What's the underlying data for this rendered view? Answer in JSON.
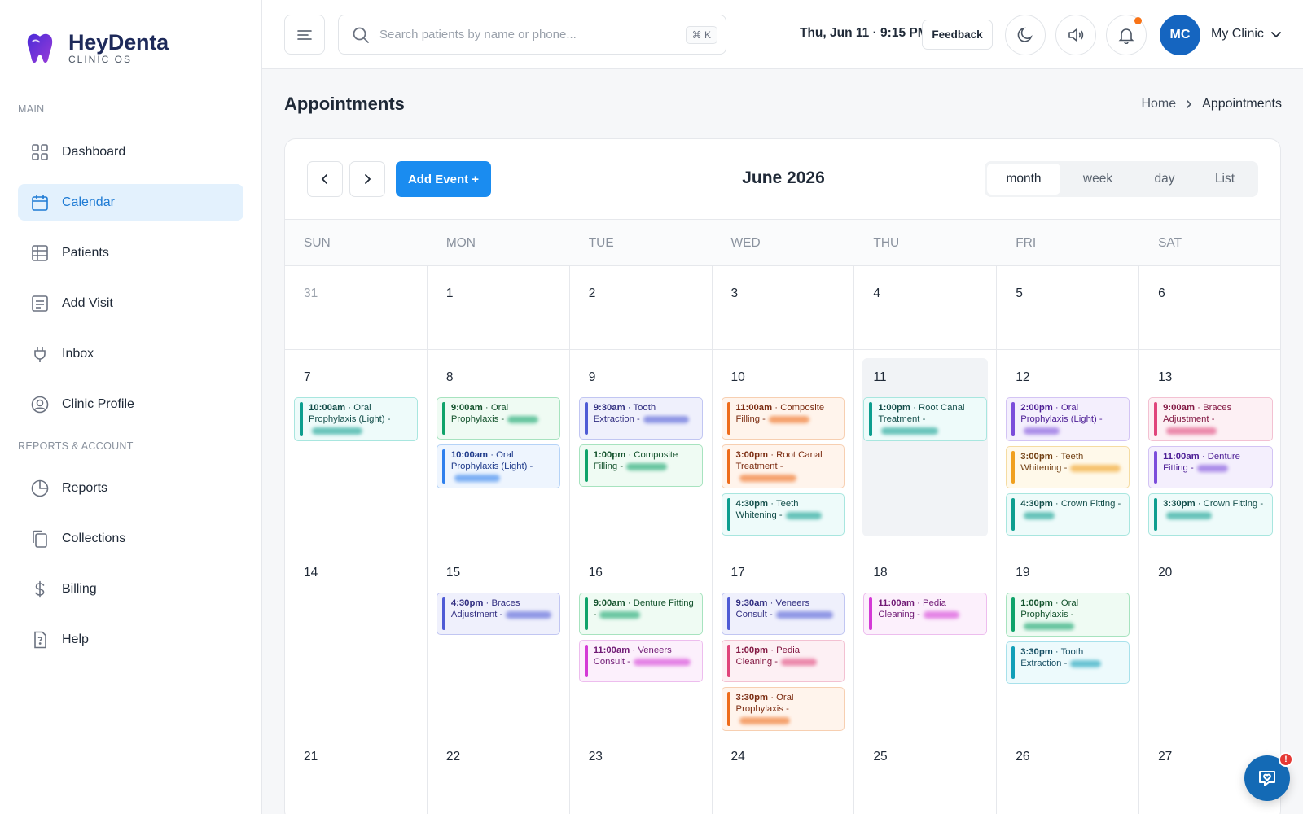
{
  "brand": {
    "name": "HeyDenta",
    "subtitle": "CLINIC OS"
  },
  "sidebar": {
    "main_label": "MAIN",
    "reports_label": "REPORTS & ACCOUNT",
    "main_items": [
      {
        "label": "Dashboard",
        "icon": "dashboard-grid-icon"
      },
      {
        "label": "Calendar",
        "icon": "calendar-icon",
        "active": true
      },
      {
        "label": "Patients",
        "icon": "table-icon"
      },
      {
        "label": "Add Visit",
        "icon": "document-list-icon"
      },
      {
        "label": "Inbox",
        "icon": "plug-icon"
      },
      {
        "label": "Clinic Profile",
        "icon": "user-circle-icon"
      }
    ],
    "report_items": [
      {
        "label": "Reports",
        "icon": "pie-chart-icon"
      },
      {
        "label": "Collections",
        "icon": "copy-icon"
      },
      {
        "label": "Billing",
        "icon": "dollar-icon"
      },
      {
        "label": "Help",
        "icon": "help-document-icon"
      }
    ]
  },
  "topbar": {
    "search_placeholder": "Search patients by name or phone...",
    "shortcut": "⌘ K",
    "datetime": "Thu, Jun 11 · 9:15 PM",
    "feedback_label": "Feedback",
    "avatar_initials": "MC",
    "clinic_name": "My Clinic",
    "notification_dot_color": "#f97316"
  },
  "page": {
    "title": "Appointments",
    "breadcrumb_home": "Home",
    "breadcrumb_current": "Appointments"
  },
  "calendar": {
    "add_event_label": "Add Event +",
    "month_title": "June 2026",
    "views": [
      "month",
      "week",
      "day",
      "List"
    ],
    "active_view": "month",
    "weekdays": [
      "SUN",
      "MON",
      "TUE",
      "WED",
      "THU",
      "FRI",
      "SAT"
    ],
    "weeks": [
      [
        {
          "day": "31",
          "muted": true,
          "events": []
        },
        {
          "day": "1",
          "events": []
        },
        {
          "day": "2",
          "events": []
        },
        {
          "day": "3",
          "events": []
        },
        {
          "day": "4",
          "events": []
        },
        {
          "day": "5",
          "events": []
        },
        {
          "day": "6",
          "events": []
        }
      ],
      [
        {
          "day": "7",
          "events": [
            {
              "time": "10:00am",
              "title": "Oral Prophylaxis (Light) -",
              "color": "teal"
            }
          ]
        },
        {
          "day": "8",
          "events": [
            {
              "time": "9:00am",
              "title": "Oral Prophylaxis -",
              "color": "green"
            },
            {
              "time": "10:00am",
              "title": "Oral Prophylaxis (Light) -",
              "color": "blue"
            }
          ]
        },
        {
          "day": "9",
          "events": [
            {
              "time": "9:30am",
              "title": "Tooth Extraction -",
              "color": "indigo"
            },
            {
              "time": "1:00pm",
              "title": "Composite Filling -",
              "color": "green"
            }
          ]
        },
        {
          "day": "10",
          "events": [
            {
              "time": "11:00am",
              "title": "Composite Filling -",
              "color": "orange"
            },
            {
              "time": "3:00pm",
              "title": "Root Canal Treatment -",
              "color": "orange"
            },
            {
              "time": "4:30pm",
              "title": "Teeth Whitening -",
              "color": "teal"
            }
          ]
        },
        {
          "day": "11",
          "today": true,
          "events": [
            {
              "time": "1:00pm",
              "title": "Root Canal Treatment -",
              "color": "teal"
            }
          ]
        },
        {
          "day": "12",
          "events": [
            {
              "time": "2:00pm",
              "title": "Oral Prophylaxis (Light) -",
              "color": "purple"
            },
            {
              "time": "3:00pm",
              "title": "Teeth Whitening -",
              "color": "amber"
            },
            {
              "time": "4:30pm",
              "title": "Crown Fitting -",
              "color": "teal"
            }
          ]
        },
        {
          "day": "13",
          "events": [
            {
              "time": "9:00am",
              "title": "Braces Adjustment -",
              "color": "pink"
            },
            {
              "time": "11:00am",
              "title": "Denture Fitting -",
              "color": "purple"
            },
            {
              "time": "3:30pm",
              "title": "Crown Fitting -",
              "color": "teal"
            }
          ]
        }
      ],
      [
        {
          "day": "14",
          "events": []
        },
        {
          "day": "15",
          "events": [
            {
              "time": "4:30pm",
              "title": "Braces Adjustment -",
              "color": "indigo"
            }
          ]
        },
        {
          "day": "16",
          "events": [
            {
              "time": "9:00am",
              "title": "Denture Fitting -",
              "color": "green"
            },
            {
              "time": "11:00am",
              "title": "Veneers Consult -",
              "color": "magenta"
            }
          ]
        },
        {
          "day": "17",
          "events": [
            {
              "time": "9:30am",
              "title": "Veneers Consult -",
              "color": "indigo"
            },
            {
              "time": "1:00pm",
              "title": "Pedia Cleaning -",
              "color": "pink"
            },
            {
              "time": "3:30pm",
              "title": "Oral Prophylaxis -",
              "color": "orange"
            }
          ]
        },
        {
          "day": "18",
          "events": [
            {
              "time": "11:00am",
              "title": "Pedia Cleaning -",
              "color": "magenta"
            }
          ]
        },
        {
          "day": "19",
          "events": [
            {
              "time": "1:00pm",
              "title": "Oral Prophylaxis -",
              "color": "green"
            },
            {
              "time": "3:30pm",
              "title": "Tooth Extraction -",
              "color": "cyan"
            }
          ]
        },
        {
          "day": "20",
          "events": []
        }
      ],
      [
        {
          "day": "21",
          "events": []
        },
        {
          "day": "22",
          "events": []
        },
        {
          "day": "23",
          "events": []
        },
        {
          "day": "24",
          "events": []
        },
        {
          "day": "25",
          "events": []
        },
        {
          "day": "26",
          "events": []
        },
        {
          "day": "27",
          "events": []
        }
      ]
    ]
  },
  "colors": {
    "accent": "#1a8cf0",
    "active_nav_bg": "#e3f1fd",
    "active_nav_text": "#1e7bd4",
    "event_palette": {
      "teal": {
        "bar": "#0d9e8f",
        "bg": "#eefbfa",
        "border": "#a8e6df",
        "text": "#134e4a"
      },
      "green": {
        "bar": "#10a36a",
        "bg": "#effbf3",
        "border": "#a7e3bf",
        "text": "#14532d"
      },
      "blue": {
        "bar": "#2f80ed",
        "bg": "#eef5fe",
        "border": "#b5d3f7",
        "text": "#1e3a8a"
      },
      "indigo": {
        "bar": "#4f5bd5",
        "bg": "#eff0fc",
        "border": "#c1c6f2",
        "text": "#312e81"
      },
      "orange": {
        "bar": "#ee6c1b",
        "bg": "#fff4ec",
        "border": "#f7cfb1",
        "text": "#7c2d12"
      },
      "purple": {
        "bar": "#7c4ddb",
        "bg": "#f4effd",
        "border": "#d3c4f4",
        "text": "#4c1d95"
      },
      "amber": {
        "bar": "#f0a020",
        "bg": "#fff9ea",
        "border": "#f5dca2",
        "text": "#713f12"
      },
      "pink": {
        "bar": "#e0457b",
        "bg": "#fdf0f4",
        "border": "#f3c1d2",
        "text": "#831843"
      },
      "magenta": {
        "bar": "#d43ad6",
        "bg": "#fcf0fc",
        "border": "#edbdee",
        "text": "#701a75"
      },
      "cyan": {
        "bar": "#119fb8",
        "bg": "#edfafc",
        "border": "#a8e1eb",
        "text": "#164e63"
      }
    }
  }
}
